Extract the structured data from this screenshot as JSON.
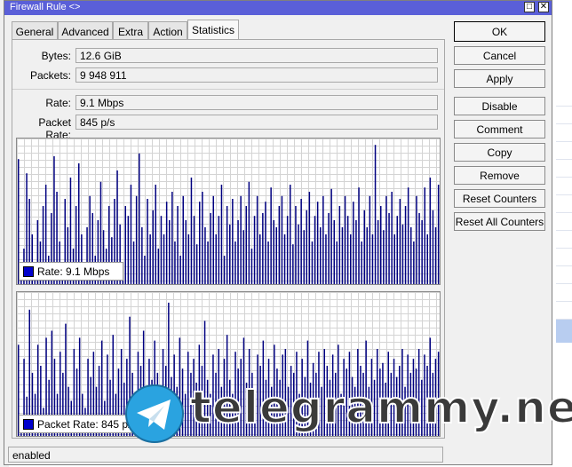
{
  "window": {
    "title": "Firewall Rule <>",
    "max_glyph": "□",
    "close_glyph": "✕"
  },
  "tabs": [
    "General",
    "Advanced",
    "Extra",
    "Action",
    "Statistics"
  ],
  "active_tab": "Statistics",
  "stats": {
    "bytes_label": "Bytes:",
    "bytes_value": "12.6 GiB",
    "packets_label": "Packets:",
    "packets_value": "9 948 911",
    "rate_label": "Rate:",
    "rate_value": "9.1 Mbps",
    "packet_rate_label": "Packet Rate:",
    "packet_rate_value": "845 p/s"
  },
  "graphs": {
    "rate_legend_name": "Rate:",
    "rate_legend_value": "9.1 Mbps",
    "packet_legend_name": "Packet Rate:",
    "packet_legend_value": "845 p/s",
    "series_color": "#000080",
    "legend_color": "#0000cc",
    "rate_bars": [
      0.88,
      0.12,
      0.25,
      0.78,
      0.6,
      0.35,
      0.12,
      0.45,
      0.3,
      0.55,
      0.7,
      0.2,
      0.5,
      0.9,
      0.65,
      0.3,
      0.15,
      0.6,
      0.4,
      0.75,
      0.25,
      0.55,
      0.85,
      0.35,
      0.1,
      0.4,
      0.62,
      0.5,
      0.2,
      0.45,
      0.72,
      0.38,
      0.25,
      0.55,
      0.33,
      0.6,
      0.8,
      0.42,
      0.15,
      0.55,
      0.48,
      0.7,
      0.3,
      0.62,
      0.92,
      0.4,
      0.2,
      0.6,
      0.35,
      0.52,
      0.7,
      0.25,
      0.48,
      0.35,
      0.58,
      0.45,
      0.65,
      0.3,
      0.55,
      0.2,
      0.62,
      0.45,
      0.35,
      0.75,
      0.48,
      0.28,
      0.58,
      0.65,
      0.4,
      0.3,
      0.5,
      0.62,
      0.35,
      0.48,
      0.7,
      0.2,
      0.55,
      0.42,
      0.6,
      0.3,
      0.45,
      0.62,
      0.38,
      0.55,
      0.72,
      0.25,
      0.48,
      0.62,
      0.35,
      0.5,
      0.58,
      0.3,
      0.68,
      0.45,
      0.4,
      0.55,
      0.62,
      0.35,
      0.48,
      0.7,
      0.28,
      0.55,
      0.42,
      0.6,
      0.38,
      0.52,
      0.65,
      0.3,
      0.48,
      0.58,
      0.4,
      0.62,
      0.35,
      0.5,
      0.67,
      0.45,
      0.3,
      0.55,
      0.4,
      0.62,
      0.48,
      0.35,
      0.58,
      0.45,
      0.68,
      0.3,
      0.52,
      0.4,
      0.62,
      0.35,
      0.98,
      0.45,
      0.55,
      0.38,
      0.62,
      0.5,
      0.65,
      0.35,
      0.48,
      0.6,
      0.42,
      0.55,
      0.68,
      0.4,
      0.3,
      0.62,
      0.5,
      0.45,
      0.68,
      0.35,
      0.75,
      0.52,
      0.4,
      0.7
    ],
    "packet_bars": [
      0.65,
      0.15,
      0.55,
      0.28,
      0.9,
      0.45,
      0.3,
      0.65,
      0.5,
      0.2,
      0.7,
      0.4,
      0.75,
      0.55,
      0.3,
      0.6,
      0.45,
      0.8,
      0.35,
      0.25,
      0.62,
      0.48,
      0.7,
      0.3,
      0.2,
      0.55,
      0.42,
      0.6,
      0.35,
      0.5,
      0.68,
      0.25,
      0.58,
      0.4,
      0.72,
      0.3,
      0.48,
      0.62,
      0.38,
      0.55,
      0.85,
      0.45,
      0.3,
      0.6,
      0.5,
      0.75,
      0.35,
      0.55,
      0.4,
      0.68,
      0.45,
      0.3,
      0.62,
      0.5,
      0.95,
      0.42,
      0.58,
      0.35,
      0.7,
      0.48,
      0.3,
      0.6,
      0.45,
      0.55,
      0.38,
      0.65,
      0.5,
      0.82,
      0.4,
      0.3,
      0.58,
      0.45,
      0.62,
      0.35,
      0.55,
      0.72,
      0.4,
      0.3,
      0.6,
      0.48,
      0.55,
      0.7,
      0.38,
      0.62,
      0.45,
      0.3,
      0.58,
      0.5,
      0.68,
      0.4,
      0.55,
      0.35,
      0.65,
      0.48,
      0.4,
      0.58,
      0.62,
      0.35,
      0.5,
      0.45,
      0.6,
      0.3,
      0.55,
      0.42,
      0.68,
      0.38,
      0.52,
      0.45,
      0.6,
      0.35,
      0.62,
      0.5,
      0.4,
      0.58,
      0.45,
      0.65,
      0.3,
      0.55,
      0.48,
      0.6,
      0.42,
      0.35,
      0.62,
      0.5,
      0.45,
      0.68,
      0.35,
      0.55,
      0.4,
      0.62,
      0.48,
      0.52,
      0.38,
      0.6,
      0.45,
      0.55,
      0.42,
      0.5,
      0.62,
      0.35,
      0.58,
      0.45,
      0.55,
      0.48,
      0.62,
      0.4,
      0.58,
      0.5,
      0.7,
      0.45,
      0.55,
      0.6
    ]
  },
  "buttons": {
    "ok": "OK",
    "cancel": "Cancel",
    "apply": "Apply",
    "disable": "Disable",
    "comment": "Comment",
    "copy": "Copy",
    "remove": "Remove",
    "reset_counters": "Reset Counters",
    "reset_all_counters": "Reset All Counters"
  },
  "status": "enabled",
  "watermark": {
    "text": "telegrammy.net",
    "logo": "telegram-plane-logo",
    "logo_color": "#2aa3e0"
  }
}
